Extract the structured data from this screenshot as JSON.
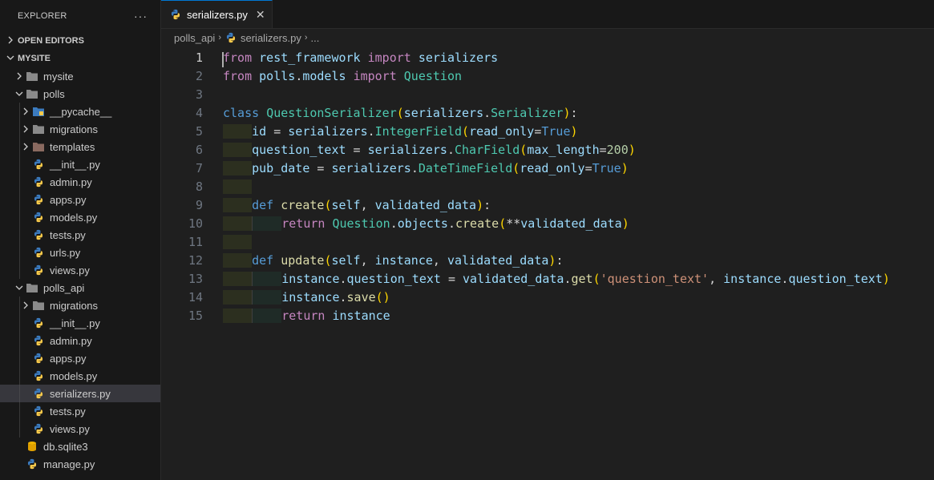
{
  "explorer": {
    "title": "EXPLORER",
    "more": "···",
    "open_editors": "OPEN EDITORS",
    "workspace": "MYSITE",
    "tree": [
      {
        "label": "mysite",
        "type": "folder",
        "depth": 1,
        "expanded": false
      },
      {
        "label": "polls",
        "type": "folder",
        "depth": 1,
        "expanded": true
      },
      {
        "label": "__pycache__",
        "type": "folder-py",
        "depth": 2,
        "expanded": false
      },
      {
        "label": "migrations",
        "type": "folder",
        "depth": 2,
        "expanded": false
      },
      {
        "label": "templates",
        "type": "folder-tpl",
        "depth": 2,
        "expanded": false
      },
      {
        "label": "__init__.py",
        "type": "py",
        "depth": 2
      },
      {
        "label": "admin.py",
        "type": "py",
        "depth": 2
      },
      {
        "label": "apps.py",
        "type": "py",
        "depth": 2
      },
      {
        "label": "models.py",
        "type": "py",
        "depth": 2
      },
      {
        "label": "tests.py",
        "type": "py",
        "depth": 2
      },
      {
        "label": "urls.py",
        "type": "py",
        "depth": 2
      },
      {
        "label": "views.py",
        "type": "py",
        "depth": 2
      },
      {
        "label": "polls_api",
        "type": "folder",
        "depth": 1,
        "expanded": true
      },
      {
        "label": "migrations",
        "type": "folder",
        "depth": 2,
        "expanded": false
      },
      {
        "label": "__init__.py",
        "type": "py",
        "depth": 2
      },
      {
        "label": "admin.py",
        "type": "py",
        "depth": 2
      },
      {
        "label": "apps.py",
        "type": "py",
        "depth": 2
      },
      {
        "label": "models.py",
        "type": "py",
        "depth": 2
      },
      {
        "label": "serializers.py",
        "type": "py",
        "depth": 2,
        "selected": true
      },
      {
        "label": "tests.py",
        "type": "py",
        "depth": 2
      },
      {
        "label": "views.py",
        "type": "py",
        "depth": 2
      },
      {
        "label": "db.sqlite3",
        "type": "db",
        "depth": 1
      },
      {
        "label": "manage.py",
        "type": "py",
        "depth": 1
      }
    ]
  },
  "tab": {
    "label": "serializers.py",
    "close": "✕"
  },
  "breadcrumb": {
    "folder": "polls_api",
    "file": "serializers.py",
    "more": "..."
  },
  "colors": {
    "accent": "#0078d4",
    "selected": "#37373d",
    "python_blue": "#3b7bbf",
    "python_yellow": "#f7c94b"
  },
  "code": {
    "active_line": 1,
    "lines": [
      [
        [
          "kw",
          "from"
        ],
        [
          "op",
          " "
        ],
        [
          "var",
          "rest_framework"
        ],
        [
          "op",
          " "
        ],
        [
          "kw",
          "import"
        ],
        [
          "op",
          " "
        ],
        [
          "var",
          "serializers"
        ]
      ],
      [
        [
          "kw",
          "from"
        ],
        [
          "op",
          " "
        ],
        [
          "var",
          "polls"
        ],
        [
          "op",
          "."
        ],
        [
          "var",
          "models"
        ],
        [
          "op",
          " "
        ],
        [
          "kw",
          "import"
        ],
        [
          "op",
          " "
        ],
        [
          "cls",
          "Question"
        ]
      ],
      [],
      [
        [
          "kw2",
          "class"
        ],
        [
          "op",
          " "
        ],
        [
          "cls",
          "QuestionSerializer"
        ],
        [
          "p1",
          "("
        ],
        [
          "var",
          "serializers"
        ],
        [
          "op",
          "."
        ],
        [
          "cls",
          "Serializer"
        ],
        [
          "p1",
          ")"
        ],
        [
          "op",
          ":"
        ]
      ],
      [
        [
          "ind1",
          "    "
        ],
        [
          "var",
          "id"
        ],
        [
          "op",
          " = "
        ],
        [
          "var",
          "serializers"
        ],
        [
          "op",
          "."
        ],
        [
          "cls",
          "IntegerField"
        ],
        [
          "p1",
          "("
        ],
        [
          "var",
          "read_only"
        ],
        [
          "op",
          "="
        ],
        [
          "kw2",
          "True"
        ],
        [
          "p1",
          ")"
        ]
      ],
      [
        [
          "ind1",
          "    "
        ],
        [
          "var",
          "question_text"
        ],
        [
          "op",
          " = "
        ],
        [
          "var",
          "serializers"
        ],
        [
          "op",
          "."
        ],
        [
          "cls",
          "CharField"
        ],
        [
          "p1",
          "("
        ],
        [
          "var",
          "max_length"
        ],
        [
          "op",
          "="
        ],
        [
          "num",
          "200"
        ],
        [
          "p1",
          ")"
        ]
      ],
      [
        [
          "ind1",
          "    "
        ],
        [
          "var",
          "pub_date"
        ],
        [
          "op",
          " = "
        ],
        [
          "var",
          "serializers"
        ],
        [
          "op",
          "."
        ],
        [
          "cls",
          "DateTimeField"
        ],
        [
          "p1",
          "("
        ],
        [
          "var",
          "read_only"
        ],
        [
          "op",
          "="
        ],
        [
          "kw2",
          "True"
        ],
        [
          "p1",
          ")"
        ]
      ],
      [
        [
          "ind1",
          "    "
        ]
      ],
      [
        [
          "ind1",
          "    "
        ],
        [
          "kw2",
          "def"
        ],
        [
          "op",
          " "
        ],
        [
          "fn",
          "create"
        ],
        [
          "p1",
          "("
        ],
        [
          "var",
          "self"
        ],
        [
          "op",
          ", "
        ],
        [
          "var",
          "validated_data"
        ],
        [
          "p1",
          ")"
        ],
        [
          "op",
          ":"
        ]
      ],
      [
        [
          "ind1",
          "    "
        ],
        [
          "ind2",
          "    "
        ],
        [
          "kw",
          "return"
        ],
        [
          "op",
          " "
        ],
        [
          "cls",
          "Question"
        ],
        [
          "op",
          "."
        ],
        [
          "var",
          "objects"
        ],
        [
          "op",
          "."
        ],
        [
          "fn",
          "create"
        ],
        [
          "p1",
          "("
        ],
        [
          "op",
          "**"
        ],
        [
          "var",
          "validated_data"
        ],
        [
          "p1",
          ")"
        ]
      ],
      [
        [
          "ind1",
          "    "
        ]
      ],
      [
        [
          "ind1",
          "    "
        ],
        [
          "kw2",
          "def"
        ],
        [
          "op",
          " "
        ],
        [
          "fn",
          "update"
        ],
        [
          "p1",
          "("
        ],
        [
          "var",
          "self"
        ],
        [
          "op",
          ", "
        ],
        [
          "var",
          "instance"
        ],
        [
          "op",
          ", "
        ],
        [
          "var",
          "validated_data"
        ],
        [
          "p1",
          ")"
        ],
        [
          "op",
          ":"
        ]
      ],
      [
        [
          "ind1",
          "    "
        ],
        [
          "ind2",
          "    "
        ],
        [
          "var",
          "instance"
        ],
        [
          "op",
          "."
        ],
        [
          "var",
          "question_text"
        ],
        [
          "op",
          " = "
        ],
        [
          "var",
          "validated_data"
        ],
        [
          "op",
          "."
        ],
        [
          "fn",
          "get"
        ],
        [
          "p1",
          "("
        ],
        [
          "str",
          "'question_text'"
        ],
        [
          "op",
          ", "
        ],
        [
          "var",
          "instance"
        ],
        [
          "op",
          "."
        ],
        [
          "var",
          "question_text"
        ],
        [
          "p1",
          ")"
        ]
      ],
      [
        [
          "ind1",
          "    "
        ],
        [
          "ind2",
          "    "
        ],
        [
          "var",
          "instance"
        ],
        [
          "op",
          "."
        ],
        [
          "fn",
          "save"
        ],
        [
          "p1",
          "()"
        ]
      ],
      [
        [
          "ind1",
          "    "
        ],
        [
          "ind2",
          "    "
        ],
        [
          "kw",
          "return"
        ],
        [
          "op",
          " "
        ],
        [
          "var",
          "instance"
        ]
      ]
    ]
  }
}
